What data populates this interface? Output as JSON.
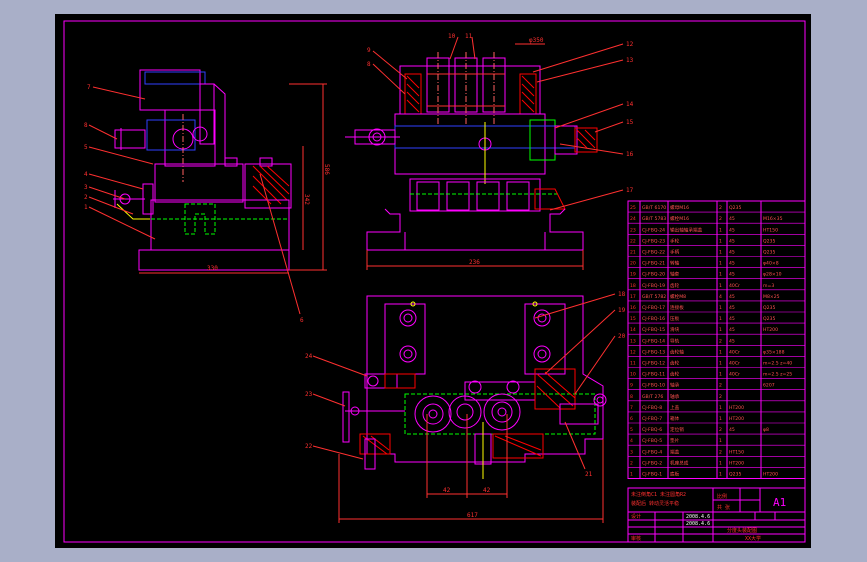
{
  "colors": {
    "background": "#000000",
    "frame": "#ff00ff",
    "geometry": "#ff00ff",
    "dimension": "#ff3030",
    "hidden": "#00ff00",
    "section_hatch": "#ff0000",
    "bolts": "#ffff00",
    "centerline": "#ff6060",
    "blue_parts": "#3040ff",
    "window_border": "#a9afc8"
  },
  "left_view": {
    "balloons": [
      "7",
      "8",
      "5",
      "4",
      "3",
      "2",
      "1"
    ],
    "dims": {
      "width": "330",
      "height_outer": "586",
      "height_inner": "342"
    },
    "leader_label": "6"
  },
  "front_view": {
    "balloons_left": [
      "9",
      "8"
    ],
    "balloons_top": [
      "10",
      "11"
    ],
    "balloons_right": [
      "12",
      "13",
      "14",
      "15",
      "16",
      "17"
    ],
    "dims": {
      "width": "236",
      "top_note": "φ350"
    }
  },
  "top_view": {
    "balloons_right": [
      "18",
      "19",
      "20"
    ],
    "balloons_left": [
      "24",
      "23",
      "22"
    ],
    "leader_label": "21",
    "dims": {
      "pitch_left": "42",
      "pitch_right": "42",
      "overall": "617"
    }
  },
  "parts_list": {
    "rows": [
      {
        "no": "25",
        "code": "GB/T 6170",
        "name": "螺母M16",
        "qty": "2",
        "material": "Q235",
        "note": ""
      },
      {
        "no": "24",
        "code": "GB/T 5783",
        "name": "螺栓M16",
        "qty": "2",
        "material": "45",
        "note": "M16×35"
      },
      {
        "no": "23",
        "code": "CJ-FBQ-24",
        "name": "输出轴轴承端盖",
        "qty": "1",
        "material": "45",
        "note": "HT150"
      },
      {
        "no": "22",
        "code": "CJ-FBQ-23",
        "name": "手轮",
        "qty": "1",
        "material": "45",
        "note": "Q235"
      },
      {
        "no": "21",
        "code": "CJ-FBQ-22",
        "name": "手柄",
        "qty": "1",
        "material": "45",
        "note": "Q235"
      },
      {
        "no": "20",
        "code": "CJ-FBQ-21",
        "name": "转轴",
        "qty": "1",
        "material": "45",
        "note": "φ40×8"
      },
      {
        "no": "19",
        "code": "CJ-FBQ-20",
        "name": "轴套",
        "qty": "1",
        "material": "45",
        "note": "φ28×10"
      },
      {
        "no": "18",
        "code": "CJ-FBQ-19",
        "name": "齿轮",
        "qty": "1",
        "material": "40Cr",
        "note": "m=3"
      },
      {
        "no": "17",
        "code": "GB/T 5782",
        "name": "螺栓M8",
        "qty": "4",
        "material": "45",
        "note": "M8×25"
      },
      {
        "no": "16",
        "code": "CJ-FBQ-17",
        "name": "连接板",
        "qty": "1",
        "material": "45",
        "note": "Q235"
      },
      {
        "no": "15",
        "code": "CJ-FBQ-16",
        "name": "压板",
        "qty": "1",
        "material": "45",
        "note": "Q235"
      },
      {
        "no": "14",
        "code": "CJ-FBQ-15",
        "name": "滑块",
        "qty": "1",
        "material": "45",
        "note": "HT200"
      },
      {
        "no": "13",
        "code": "CJ-FBQ-14",
        "name": "导轨",
        "qty": "2",
        "material": "45",
        "note": ""
      },
      {
        "no": "12",
        "code": "CJ-FBQ-13",
        "name": "齿轮轴",
        "qty": "1",
        "material": "40Cr",
        "note": "φ35×188"
      },
      {
        "no": "11",
        "code": "CJ-FBQ-12",
        "name": "齿轮",
        "qty": "1",
        "material": "40Cr",
        "note": "m=2.5 z=40"
      },
      {
        "no": "10",
        "code": "CJ-FBQ-11",
        "name": "齿轮",
        "qty": "1",
        "material": "40Cr",
        "note": "m=2.5 z=25"
      },
      {
        "no": "9",
        "code": "CJ-FBQ-10",
        "name": "轴承",
        "qty": "2",
        "material": "",
        "note": "6207"
      },
      {
        "no": "8",
        "code": "GB/T 276",
        "name": "轴承",
        "qty": "2",
        "material": "",
        "note": ""
      },
      {
        "no": "7",
        "code": "CJ-FBQ-8",
        "name": "上盖",
        "qty": "1",
        "material": "HT200",
        "note": ""
      },
      {
        "no": "6",
        "code": "CJ-FBQ-7",
        "name": "箱体",
        "qty": "1",
        "material": "HT200",
        "note": ""
      },
      {
        "no": "5",
        "code": "CJ-FBQ-6",
        "name": "定位销",
        "qty": "2",
        "material": "45",
        "note": "φ8"
      },
      {
        "no": "4",
        "code": "CJ-FBQ-5",
        "name": "垫片",
        "qty": "1",
        "material": "",
        "note": ""
      },
      {
        "no": "3",
        "code": "CJ-FBQ-4",
        "name": "端盖",
        "qty": "2",
        "material": "HT150",
        "note": ""
      },
      {
        "no": "2",
        "code": "CJ-FBQ-2",
        "name": "机座总成",
        "qty": "1",
        "material": "HT200",
        "note": ""
      },
      {
        "no": "1",
        "code": "CJ-FBQ-1",
        "name": "底板",
        "qty": "1",
        "material": "Q235",
        "note": "HT200"
      }
    ],
    "header": {
      "no": "序号",
      "code": "代号",
      "name": "名称",
      "qty": "数量",
      "material": "材料",
      "note": "备注"
    }
  },
  "title_block": {
    "sheet_size": "A1",
    "scale_label": "比例",
    "sheet_label": "共 张",
    "drawing_title": "分度头装配图",
    "note_line1": "未注倒角C1 未注圆角R2",
    "note_line2": "装配后 转动灵活平稳",
    "designer_label": "设计",
    "checker_label": "审核",
    "date1": "2008.4.6",
    "date2": "2008.4.6",
    "school": "XX大学"
  }
}
